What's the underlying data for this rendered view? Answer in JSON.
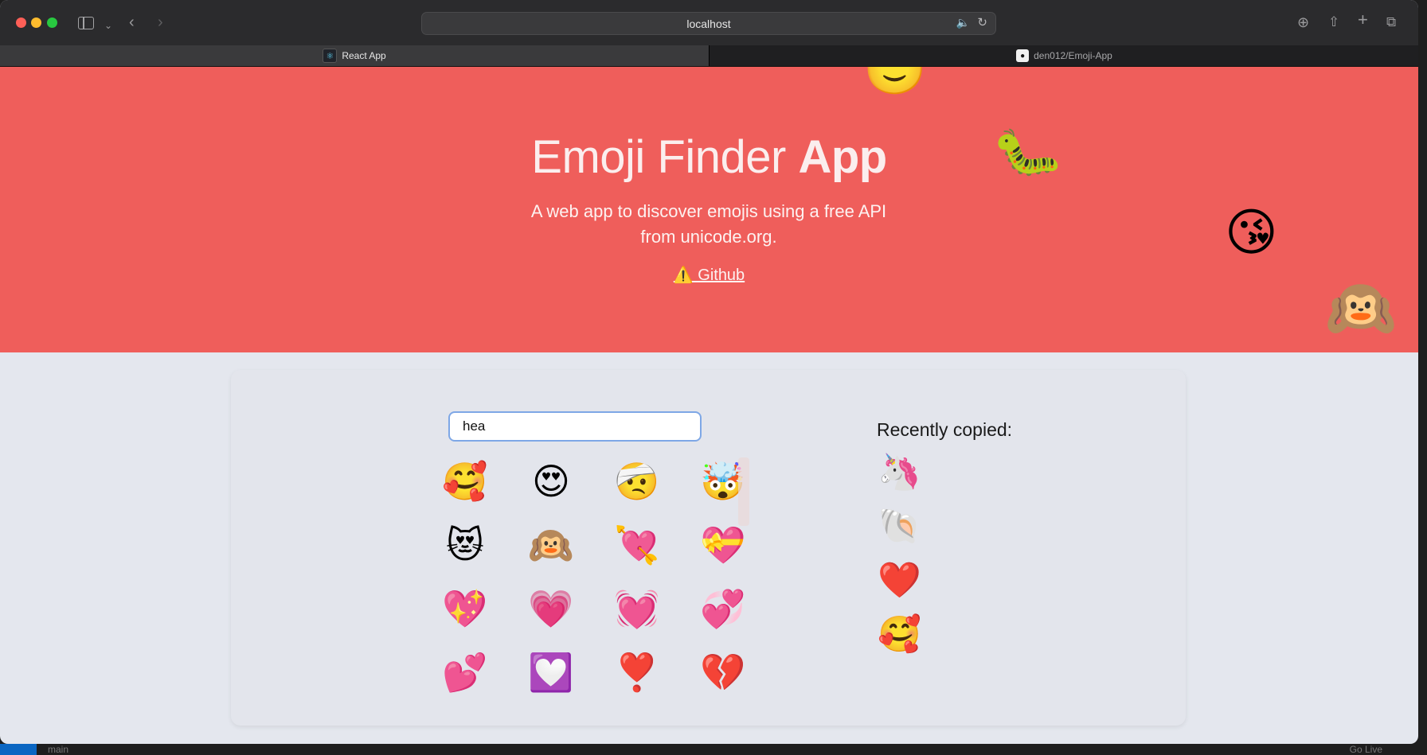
{
  "browser": {
    "address": "localhost",
    "tabs": [
      {
        "label": "React App",
        "favicon": "react-icon"
      },
      {
        "label": "den012/Emoji-App",
        "favicon": "github-icon"
      }
    ]
  },
  "hero": {
    "title_light": "Emoji Finder",
    "title_bold": "App",
    "subtitle": "A web app to discover emojis using a free API from unicode.org.",
    "link": "⚠️ Github",
    "background_color": "#ef5e5b",
    "floating_emojis": [
      "🙂",
      "🐛",
      "😘",
      "🙉"
    ]
  },
  "search": {
    "value": "hea",
    "placeholder": ""
  },
  "results": [
    "🥰",
    "😍",
    "🤕",
    "🤯",
    "😻",
    "🙉",
    "💘",
    "💝",
    "💖",
    "💗",
    "💓",
    "💞",
    "💕",
    "💟",
    "❣️",
    "💔"
  ],
  "recent": {
    "title": "Recently copied:",
    "items": [
      "🦄",
      "🐚",
      "❤️",
      "🥰"
    ]
  },
  "statusbar": {
    "left": "main",
    "right": "Go Live"
  }
}
